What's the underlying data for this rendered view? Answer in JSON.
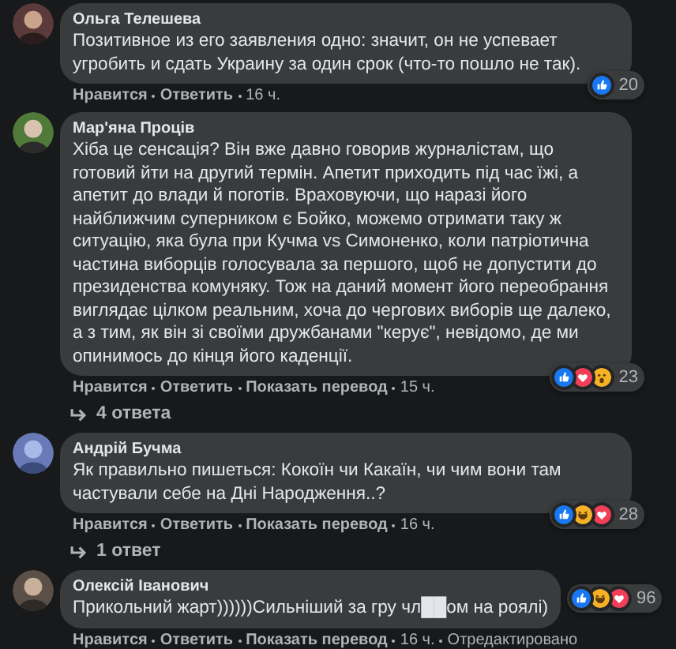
{
  "comments": [
    {
      "author": "Ольга Телешева",
      "text": "Позитивное из его заявления одно: значит, он не успевает угробить и сдать Украину за один срок (что-то пошло не так).",
      "reactions": [
        {
          "kind": "like"
        }
      ],
      "reaction_count": "20",
      "actions": [
        "Нравится",
        "Ответить"
      ],
      "time": "16 ч.",
      "avatar": {
        "kind": "picture"
      }
    },
    {
      "author": "Мар'яна Проців",
      "text": "Хіба це сенсація? Він вже давно говорив журналістам, що готовий йти на другий термін. Апетит приходить під час їжі, а апетит до влади й поготів. Враховуючи, що наразі його найближчим суперником є Бойко, можемо отримати таку ж ситуацію, яка була при Кучма vs Симоненко, коли патріотична частина виборців голосувала за першого, щоб не допустити до президенства комуняку. Тож на даний момент його переобрання виглядає цілком реальним, хоча до чергових виборів ще далеко, а з тим, як він зі своїми дружбанами \"керує\", невідомо, де ми опинимось до кінця його каденції.",
      "reactions": [
        {
          "kind": "like"
        },
        {
          "kind": "love"
        },
        {
          "kind": "wow"
        }
      ],
      "reaction_count": "23",
      "actions": [
        "Нравится",
        "Ответить",
        "Показать перевод"
      ],
      "time": "15 ч.",
      "avatar": {
        "kind": "picture"
      },
      "replies": "4 ответа"
    },
    {
      "author": "Андрій Бучма",
      "text": "Як правильно пишеться: Кокоїн чи Какаїн, чи чим вони там частували себе на Дні Народження..?",
      "reactions": [
        {
          "kind": "like"
        },
        {
          "kind": "haha"
        },
        {
          "kind": "love"
        }
      ],
      "reaction_count": "28",
      "actions": [
        "Нравится",
        "Ответить",
        "Показать перевод"
      ],
      "time": "16 ч.",
      "avatar": {
        "kind": "picture"
      },
      "replies": "1 ответ"
    },
    {
      "author": "Олексій Іванович",
      "text": "Прикольний жарт))))))Сильніший за гру чл██ом на роялі)",
      "reactions": [
        {
          "kind": "like"
        },
        {
          "kind": "haha"
        },
        {
          "kind": "love"
        }
      ],
      "reaction_count": "96",
      "actions": [
        "Нравится",
        "Ответить",
        "Показать перевод"
      ],
      "time": "16 ч.",
      "edited": "Отредактировано",
      "avatar": {
        "kind": "picture"
      }
    }
  ]
}
